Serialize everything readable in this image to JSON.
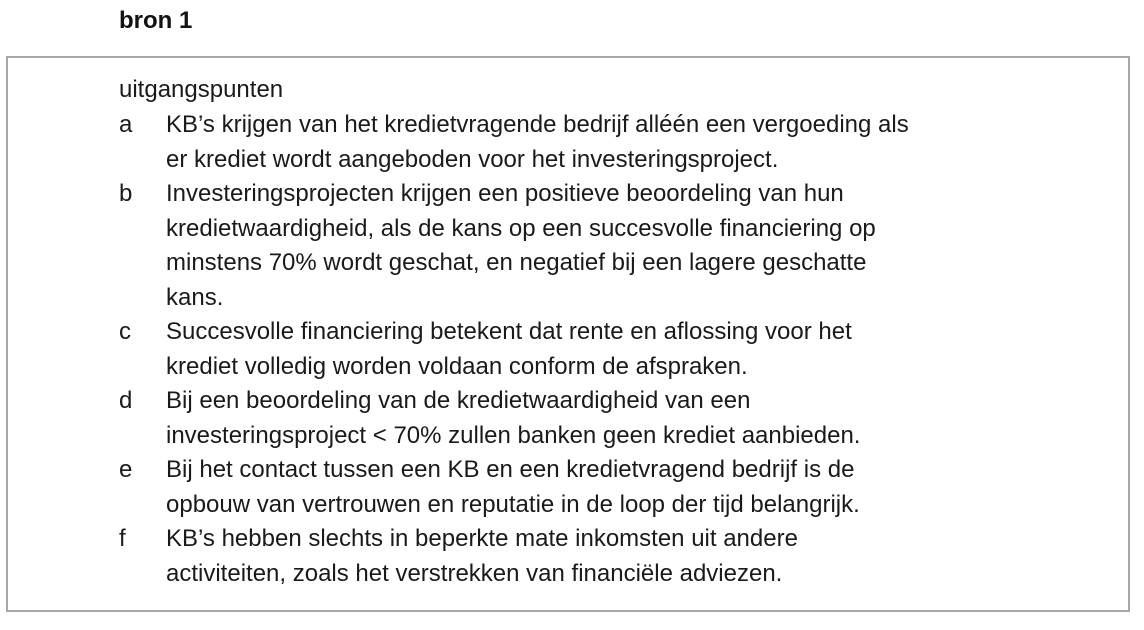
{
  "source_label": "bron 1",
  "heading": "uitgangspunten",
  "items": [
    {
      "letter": "a",
      "lines": [
        "KB’s krijgen van het kredietvragende bedrijf alléén een vergoeding als",
        "er krediet wordt aangeboden voor het investeringsproject."
      ]
    },
    {
      "letter": "b",
      "lines": [
        "Investeringsprojecten krijgen een positieve beoordeling van hun",
        "kredietwaardigheid, als de kans op een succesvolle financiering op",
        "minstens 70% wordt geschat, en negatief bij een lagere geschatte",
        "kans."
      ]
    },
    {
      "letter": "c",
      "lines": [
        "Succesvolle financiering betekent dat rente en aflossing voor het",
        "krediet volledig worden voldaan conform de afspraken."
      ]
    },
    {
      "letter": "d",
      "lines": [
        "Bij een beoordeling van de kredietwaardigheid van een",
        "investeringsproject < 70% zullen banken geen krediet aanbieden."
      ]
    },
    {
      "letter": "e",
      "lines": [
        "Bij het contact tussen een KB en een kredietvragend bedrijf is de",
        "opbouw van vertrouwen en reputatie in de loop der tijd belangrijk."
      ]
    },
    {
      "letter": "f",
      "lines": [
        "KB’s hebben slechts in beperkte mate inkomsten uit andere",
        "activiteiten, zoals het verstrekken van financiële adviezen."
      ]
    }
  ]
}
